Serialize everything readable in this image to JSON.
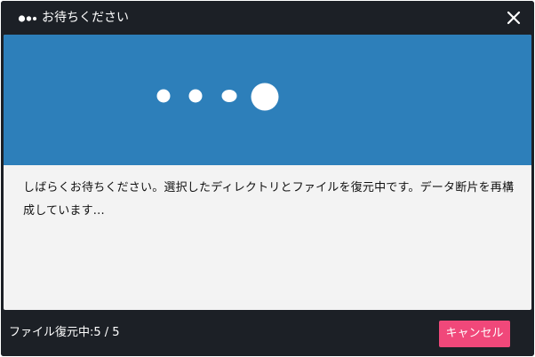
{
  "dialog": {
    "title": "お待ちください",
    "title_icon": "ellipsis-dots-icon",
    "close_icon": "close-icon"
  },
  "banner": {
    "color": "#2d7fba",
    "animation_icon": "loading-dots-icon"
  },
  "message": "しばらくお待ちください。選択したディレクトリとファイルを復元中です。データ断片を再構成しています...",
  "footer": {
    "status_label": "ファイル復元中:",
    "status_progress": "5 / 5",
    "cancel_label": "キャンセル"
  },
  "colors": {
    "frame": "#1c2026",
    "content_bg": "#f3f3f3",
    "accent_button": "#f0487a",
    "text_dark": "#111111",
    "text_light": "#ffffff"
  }
}
